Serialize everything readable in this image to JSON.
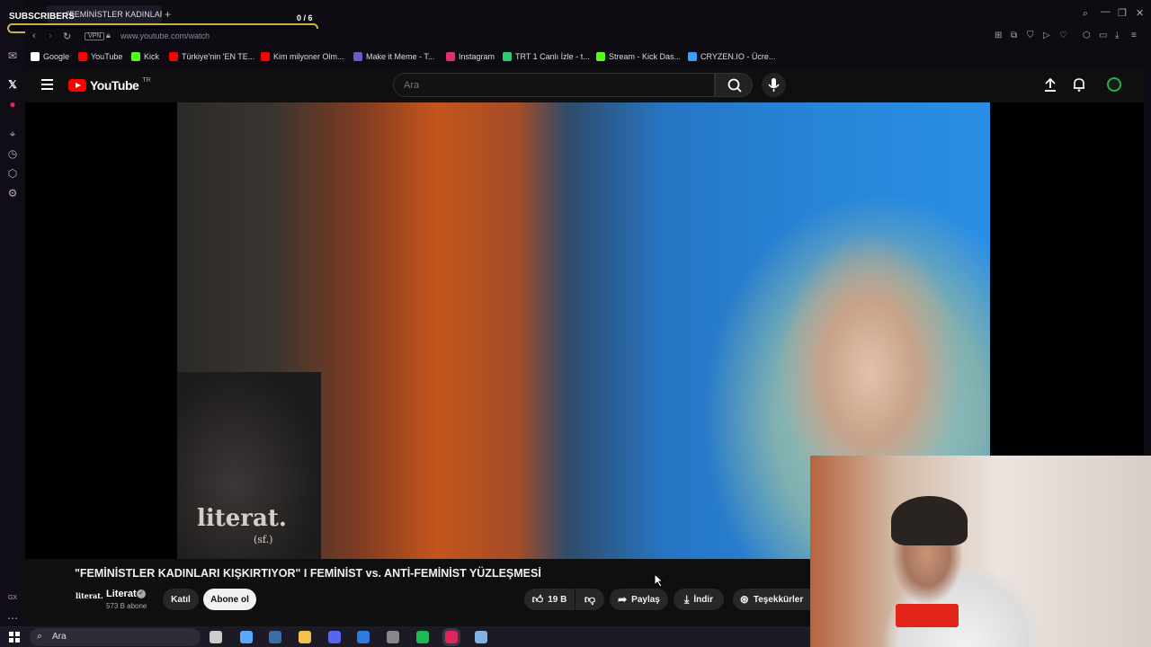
{
  "overlay": {
    "subscribers_label": "SUBSCRIBERS",
    "counter": "0 / 6"
  },
  "browser": {
    "tab_title": "\"FEMİNİSTLER KADINLARI",
    "vpn_label": "VPN",
    "url": "www.youtube.com/watch",
    "bookmarks": [
      {
        "label": "Google",
        "color": "#ffffff"
      },
      {
        "label": "YouTube",
        "color": "#ff0000"
      },
      {
        "label": "Kick",
        "color": "#53fc18"
      },
      {
        "label": "Türkiye'nin 'EN TE...",
        "color": "#ff0000"
      },
      {
        "label": "Kim milyoner Olm...",
        "color": "#ff0000"
      },
      {
        "label": "Make it Meme - T...",
        "color": "#6a5acd"
      },
      {
        "label": "Instagram",
        "color": "#e1306c"
      },
      {
        "label": "TRT 1 Canlı İzle - t...",
        "color": "#2ecc71"
      },
      {
        "label": "Stream - Kick Das...",
        "color": "#53fc18"
      },
      {
        "label": "CRYZEN.IO - Ücre...",
        "color": "#3aa0ff"
      }
    ]
  },
  "youtube": {
    "wordmark": "YouTube",
    "country": "TR",
    "search_placeholder": "Ara"
  },
  "video": {
    "watermark": "literat.",
    "watermark_sub": "(sf.)",
    "title": "\"FEMİNİSTLER KADINLARI KIŞKIRTIYOR\" I FEMİNİST vs. ANTİ-FEMİNİST YÜZLEŞMESİ",
    "channel_logo": "literat.",
    "channel_name": "Literat",
    "subscribers": "573 B abone",
    "join_label": "Katıl",
    "subscribe_label": "Abone ol",
    "likes": "19 B",
    "share_label": "Paylaş",
    "download_label": "İndir",
    "thanks_label": "Teşekkürler"
  },
  "taskbar": {
    "search_placeholder": "Ara",
    "apps": [
      {
        "name": "task-view",
        "color": "#cccccc"
      },
      {
        "name": "copilot",
        "color": "#5aa9ff"
      },
      {
        "name": "steam",
        "color": "#3a6ea5"
      },
      {
        "name": "files",
        "color": "#f2c14e"
      },
      {
        "name": "discord",
        "color": "#5865f2"
      },
      {
        "name": "mail",
        "color": "#2d7de0"
      },
      {
        "name": "obs",
        "color": "#888888"
      },
      {
        "name": "spotify",
        "color": "#1db954"
      },
      {
        "name": "opera-gx",
        "color": "#e0245e"
      },
      {
        "name": "network",
        "color": "#7fb2e5"
      }
    ]
  },
  "colors": {
    "accent_red": "#ff0000",
    "subs_bar_border": "#c9b24a"
  }
}
